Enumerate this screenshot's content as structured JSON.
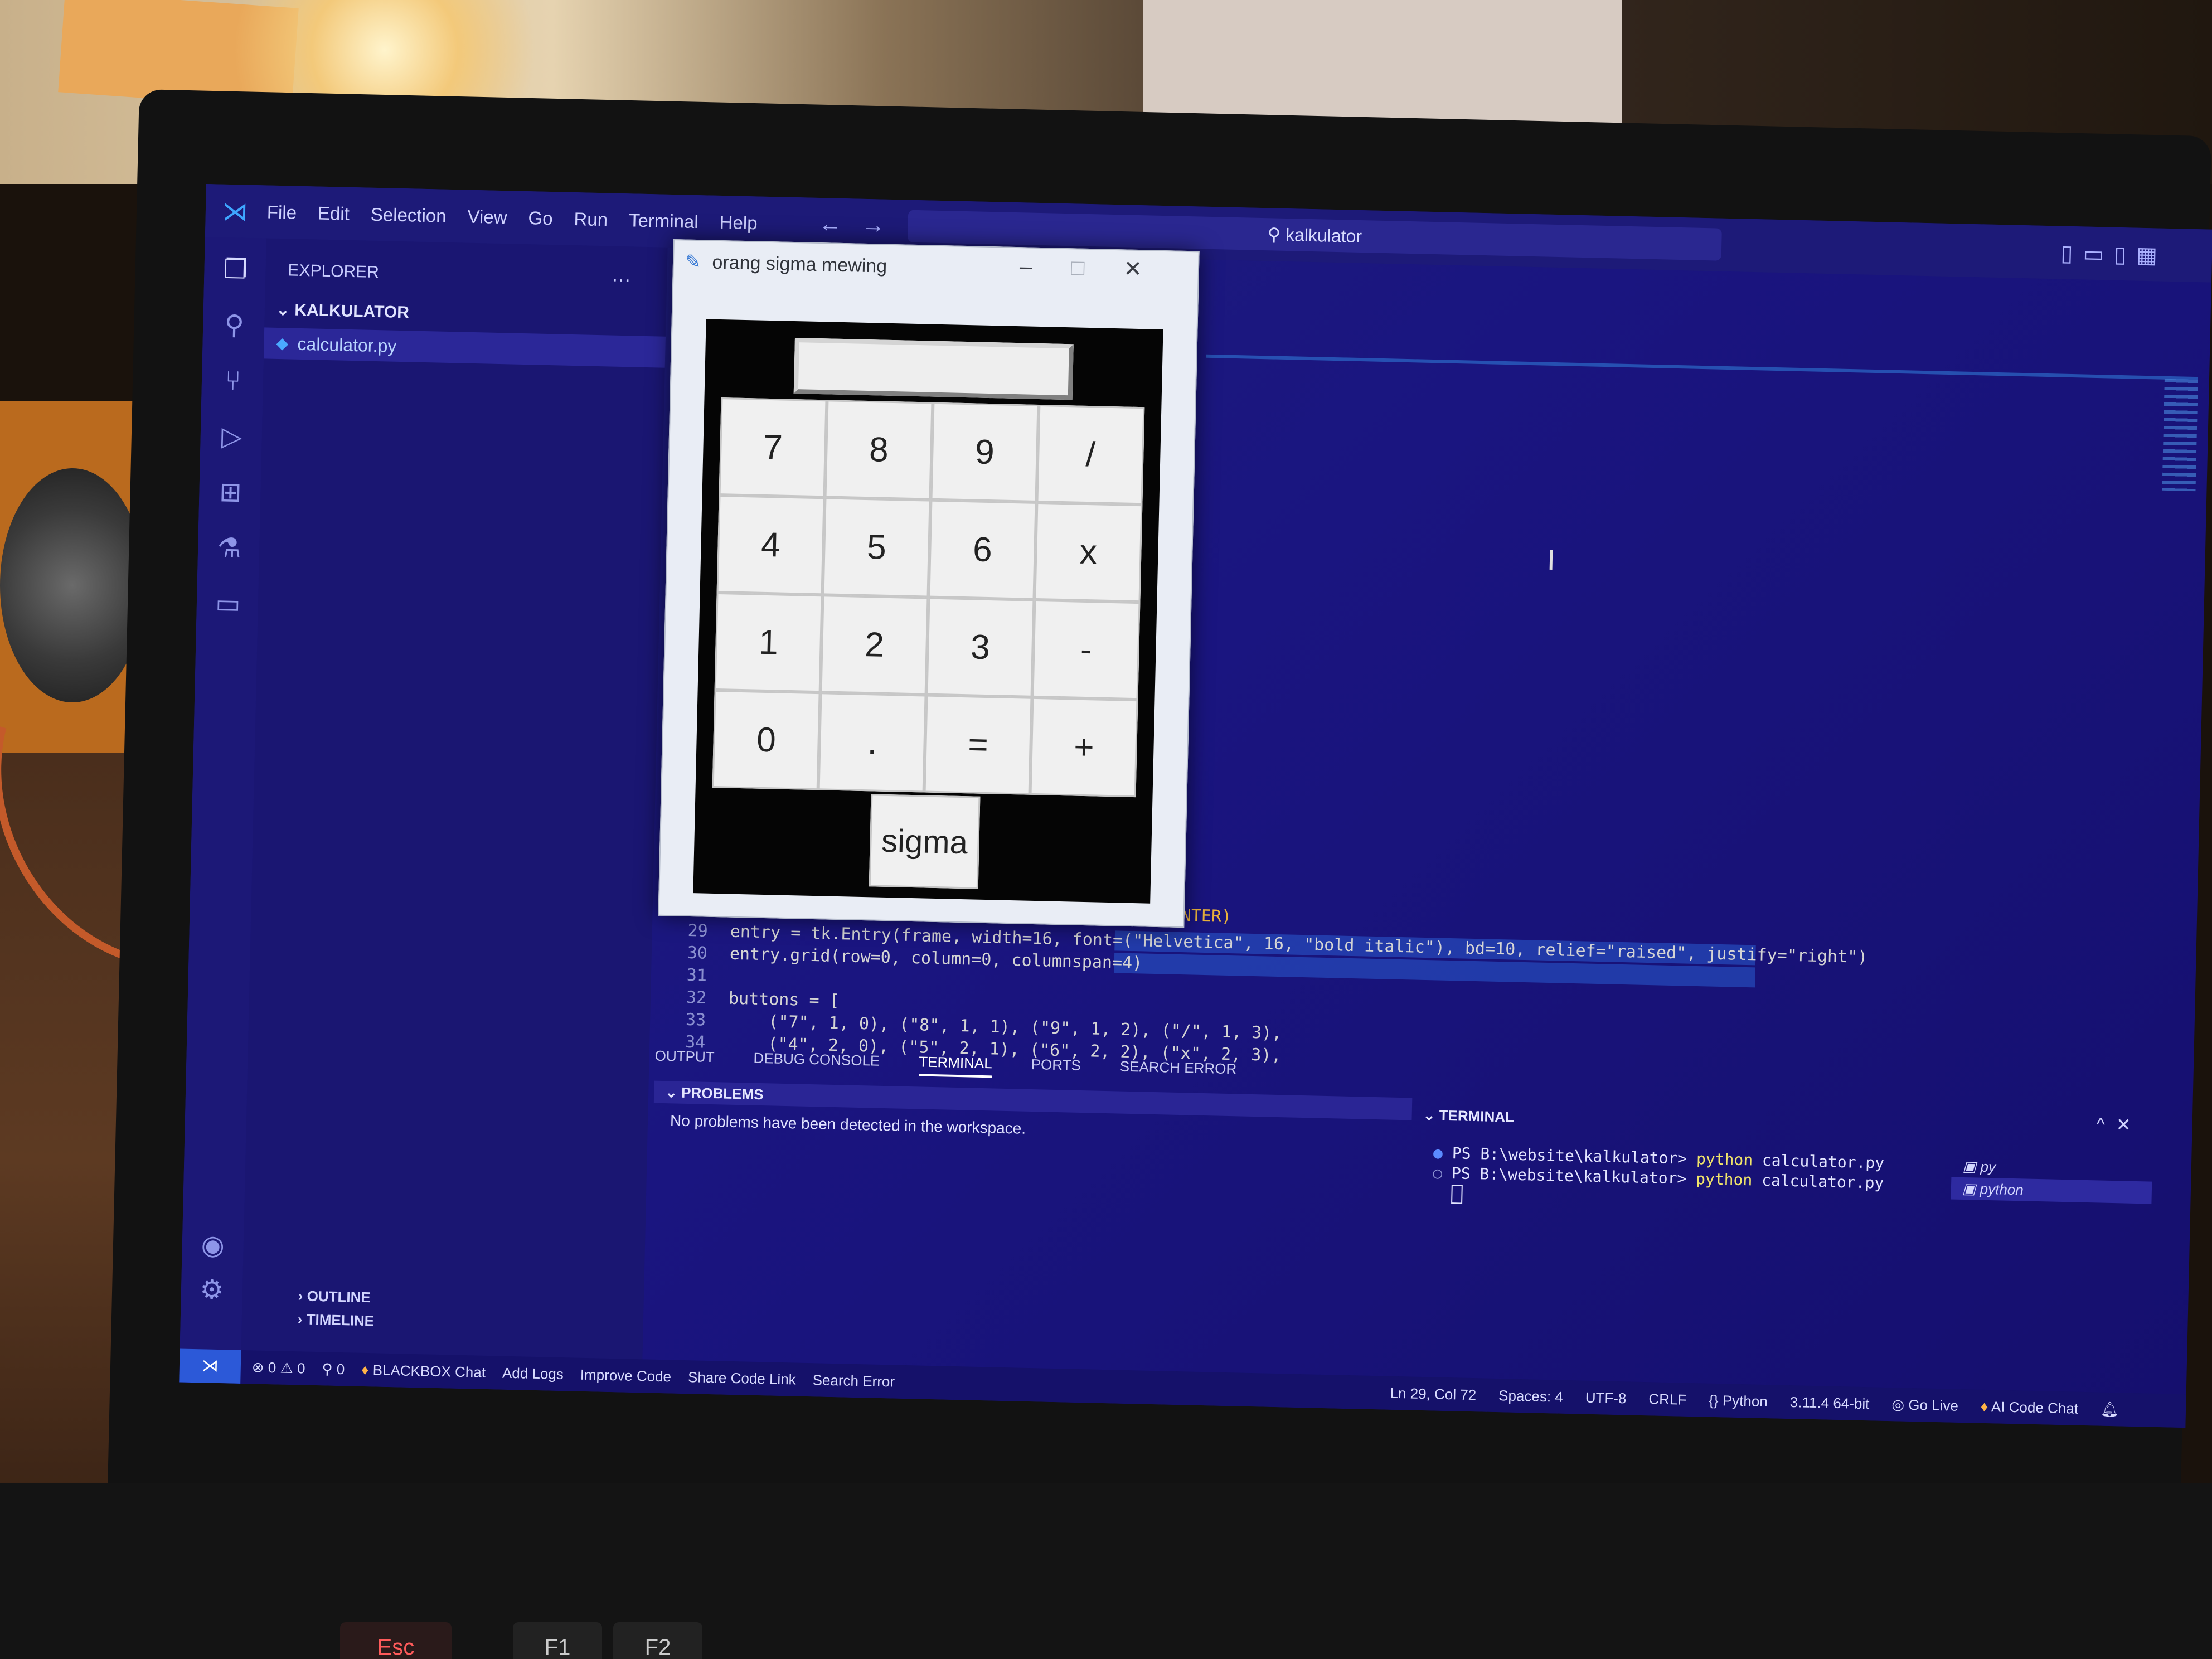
{
  "menu": {
    "items": [
      "File",
      "Edit",
      "Selection",
      "View",
      "Go",
      "Run",
      "Terminal",
      "Help"
    ]
  },
  "search": {
    "text": "kalkulator"
  },
  "explorer": {
    "header": "EXPLORER",
    "folder": "KALKULATOR",
    "file": "calculator.py",
    "outline": "OUTLINE",
    "timeline": "TIMELINE"
  },
  "calculator": {
    "title": "orang sigma mewing",
    "buttons": [
      "7",
      "8",
      "9",
      "/",
      "4",
      "5",
      "6",
      "x",
      "1",
      "2",
      "3",
      "-",
      "0",
      ".",
      "=",
      "+"
    ],
    "extra_button": "sigma"
  },
  "editor": {
    "fragment": "ENTER)",
    "lines": [
      {
        "num": "29",
        "text": "entry = tk.Entry(frame, width=16, font=(\"Helvetica\", 16, \"bold italic\"), bd=10, relief=\"raised\", justify=\"right\")"
      },
      {
        "num": "30",
        "text": "entry.grid(row=0, column=0, columnspan=4)"
      },
      {
        "num": "31",
        "text": ""
      },
      {
        "num": "32",
        "text": "buttons = ["
      },
      {
        "num": "33",
        "text": "    (\"7\", 1, 0), (\"8\", 1, 1), (\"9\", 1, 2), (\"/\", 1, 3),"
      },
      {
        "num": "34",
        "text": "    (\"4\", 2, 0), (\"5\", 2, 1), (\"6\", 2, 2), (\"x\", 2, 3),"
      }
    ]
  },
  "panel": {
    "tabs": [
      "OUTPUT",
      "DEBUG CONSOLE",
      "TERMINAL",
      "PORTS",
      "SEARCH ERROR"
    ],
    "active_tab": "TERMINAL",
    "problems_header": "PROBLEMS",
    "problems_message": "No problems have been detected in the workspace.",
    "terminal_header": "TERMINAL",
    "terminal_lines": [
      {
        "prompt": "PS B:\\website\\kalkulator>",
        "cmd": "python",
        "arg": "calculator.py"
      },
      {
        "prompt": "PS B:\\website\\kalkulator>",
        "cmd": "python",
        "arg": "calculator.py"
      }
    ],
    "terminal_list": [
      "py",
      "python"
    ]
  },
  "statusbar": {
    "problems": "⊗ 0 ⚠ 0",
    "ports": "⚲ 0",
    "left_items": [
      "BLACKBOX Chat",
      "Add Logs",
      "Improve Code",
      "Share Code Link",
      "Search Error"
    ],
    "right_items": [
      "Ln 29, Col 72",
      "Spaces: 4",
      "UTF-8",
      "CRLF",
      "{} Python",
      "3.11.4 64-bit",
      "Go Live",
      "AI Code Chat"
    ]
  },
  "keyboard": {
    "keys": [
      "Esc",
      "F1",
      "F2"
    ]
  },
  "colors": {
    "screen_bg": "#1a1580",
    "accent": "#3ea6ff",
    "terminal_cmd": "#f0e46a",
    "calc_window": "#e9edf5"
  }
}
